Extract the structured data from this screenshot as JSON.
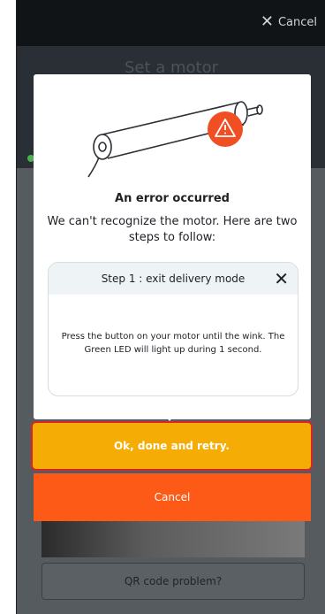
{
  "header": {
    "cancel_label": "Cancel"
  },
  "background": {
    "title": "Set a motor",
    "qr_button": "QR code problem?"
  },
  "modal": {
    "error_title": "An error occurred",
    "error_message": "We can't recognize the motor. Here are two steps to follow:",
    "step": {
      "title": "Step 1 : exit delivery mode",
      "close_icon": "close-icon",
      "body": "Press the button on your motor until the wink. The Green LED will light up during 1 second."
    },
    "ok_button": "Ok, done and retry.",
    "cancel_button": "Cancel"
  },
  "colors": {
    "accent_yellow": "#f5ad06",
    "accent_orange": "#fe5a17",
    "warning": "#f04e23",
    "focus_border": "#d7262b"
  }
}
